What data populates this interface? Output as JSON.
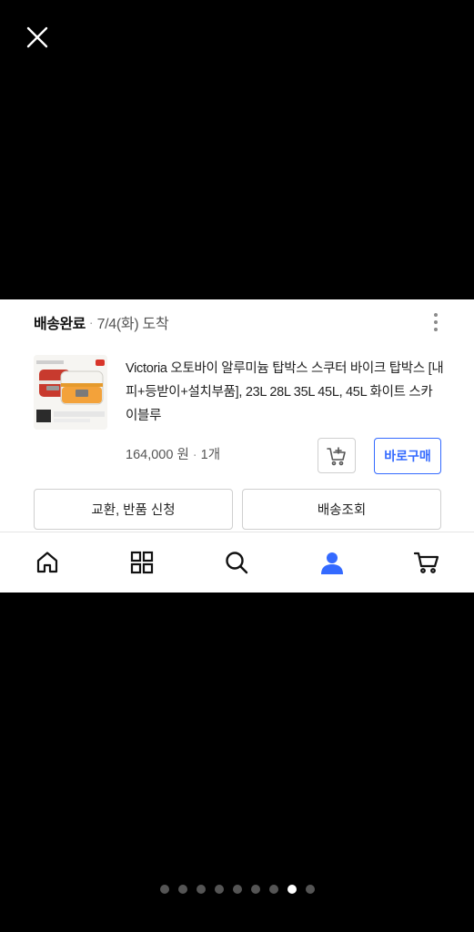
{
  "viewer": {
    "close_icon": "close-icon",
    "pager": {
      "total": 9,
      "current": 8
    }
  },
  "order": {
    "status": "배송완료",
    "separator": "·",
    "date": "7/4(화) 도착",
    "more_icon": "more-vertical-icon",
    "product": {
      "title": "Victoria 오토바이 알루미늄 탑박스 스쿠터 바이크 탑박스 [내피+등받이+설치부품], 23L 28L 35L 45L, 45L 화이트 스카이블루",
      "price": "164,000 원",
      "separator": "·",
      "quantity": "1개",
      "thumbnail_icon": "product-thumbnail"
    },
    "buttons": {
      "add_cart_icon": "cart-add-icon",
      "buy_now": "바로구매",
      "exchange_return": "교환, 반품 신청",
      "track_delivery": "배송조회"
    }
  },
  "bottom_nav": {
    "items": [
      {
        "name": "home",
        "icon": "home-icon"
      },
      {
        "name": "categories",
        "icon": "grid-icon"
      },
      {
        "name": "search",
        "icon": "search-icon"
      },
      {
        "name": "my",
        "icon": "user-icon",
        "active": true
      },
      {
        "name": "cart",
        "icon": "cart-icon"
      }
    ],
    "active_color": "#346aff",
    "inactive_color": "#111111"
  },
  "colors": {
    "accent": "#346aff",
    "background": "#000000"
  }
}
